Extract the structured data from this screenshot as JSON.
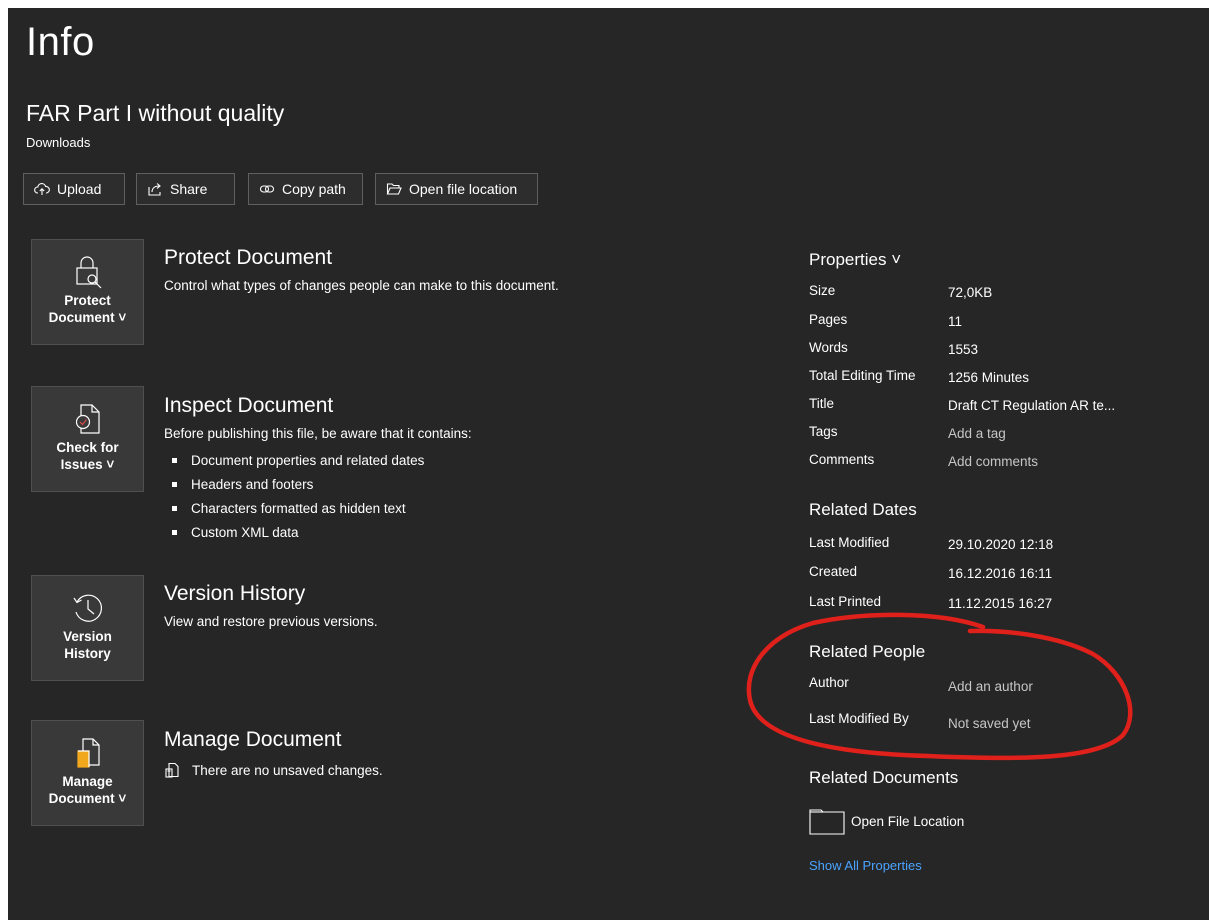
{
  "page": {
    "title": "Info"
  },
  "document": {
    "name": "FAR Part I without quality",
    "location": "Downloads"
  },
  "actions": [
    {
      "label": "Upload",
      "icon": "cloud-upload-icon"
    },
    {
      "label": "Share",
      "icon": "share-icon"
    },
    {
      "label": "Copy path",
      "icon": "link-icon"
    },
    {
      "label": "Open file location",
      "icon": "folder-open-icon"
    }
  ],
  "sections": {
    "protect": {
      "tile_line1": "Protect",
      "tile_line2": "Document ˅",
      "title": "Protect Document",
      "desc": "Control what types of changes people can make to this document."
    },
    "inspect": {
      "tile_line1": "Check for",
      "tile_line2": "Issues ˅",
      "title": "Inspect Document",
      "desc": "Before publishing this file, be aware that it contains:",
      "bullets": [
        "Document properties and related dates",
        "Headers and footers",
        "Characters formatted as hidden text",
        "Custom XML data"
      ]
    },
    "version": {
      "tile_line1": "Version",
      "tile_line2": "History",
      "title": "Version History",
      "desc": "View and restore previous versions."
    },
    "manage": {
      "tile_line1": "Manage",
      "tile_line2": "Document ˅",
      "title": "Manage Document",
      "desc": "There are no unsaved changes."
    }
  },
  "properties": {
    "heading": "Properties ˅",
    "size_label": "Size",
    "size": "72,0KB",
    "pages_label": "Pages",
    "pages": "11",
    "words_label": "Words",
    "words": "1553",
    "editing_label": "Total Editing Time",
    "editing": "1256 Minutes",
    "title_label": "Title",
    "title": "Draft CT Regulation AR te...",
    "tags_label": "Tags",
    "tags": "Add a tag",
    "comments_label": "Comments",
    "comments": "Add comments"
  },
  "related_dates": {
    "heading": "Related Dates",
    "modified_label": "Last Modified",
    "modified": "29.10.2020 12:18",
    "created_label": "Created",
    "created": "16.12.2016 16:11",
    "printed_label": "Last Printed",
    "printed": "11.12.2015 16:27"
  },
  "related_people": {
    "heading": "Related People",
    "author_label": "Author",
    "author": "Add an author",
    "modified_by_label": "Last Modified By",
    "modified_by": "Not saved yet"
  },
  "related_documents": {
    "heading": "Related Documents",
    "open_location": "Open File Location",
    "show_all": "Show All Properties"
  },
  "colors": {
    "background": "#262626",
    "tile": "#393939",
    "link": "#4aa3ff",
    "annotation": "#e0201b",
    "accent_orange": "#f2a81d"
  }
}
